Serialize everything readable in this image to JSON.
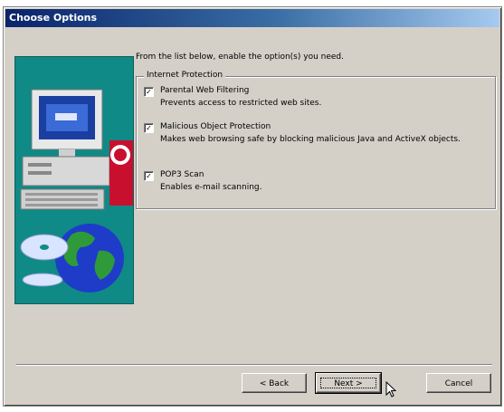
{
  "window": {
    "title": "Choose Options"
  },
  "intro_text": "From the list below, enable the option(s) you need.",
  "group": {
    "legend": "Internet Protection",
    "options": [
      {
        "label": "Parental Web Filtering",
        "description": "Prevents access to restricted web sites.",
        "checked": true,
        "check_glyph": "✓"
      },
      {
        "label": "Malicious Object Protection",
        "description": "Makes web browsing safe by blocking malicious Java and ActiveX objects.",
        "checked": true,
        "check_glyph": "✓"
      },
      {
        "label": "POP3 Scan",
        "description": "Enables e-mail scanning.",
        "checked": true,
        "check_glyph": "✓"
      }
    ]
  },
  "buttons": {
    "back": "< Back",
    "next": "Next >",
    "cancel": "Cancel"
  },
  "colors": {
    "dialog_bg": "#d4d0c8",
    "title_gradient_start": "#0a246a",
    "title_gradient_end": "#a6caf0",
    "art_bg": "#0f8a86"
  },
  "icons": {
    "art": "computer-with-globe-and-cds",
    "cursor": "mouse-pointer-icon"
  }
}
